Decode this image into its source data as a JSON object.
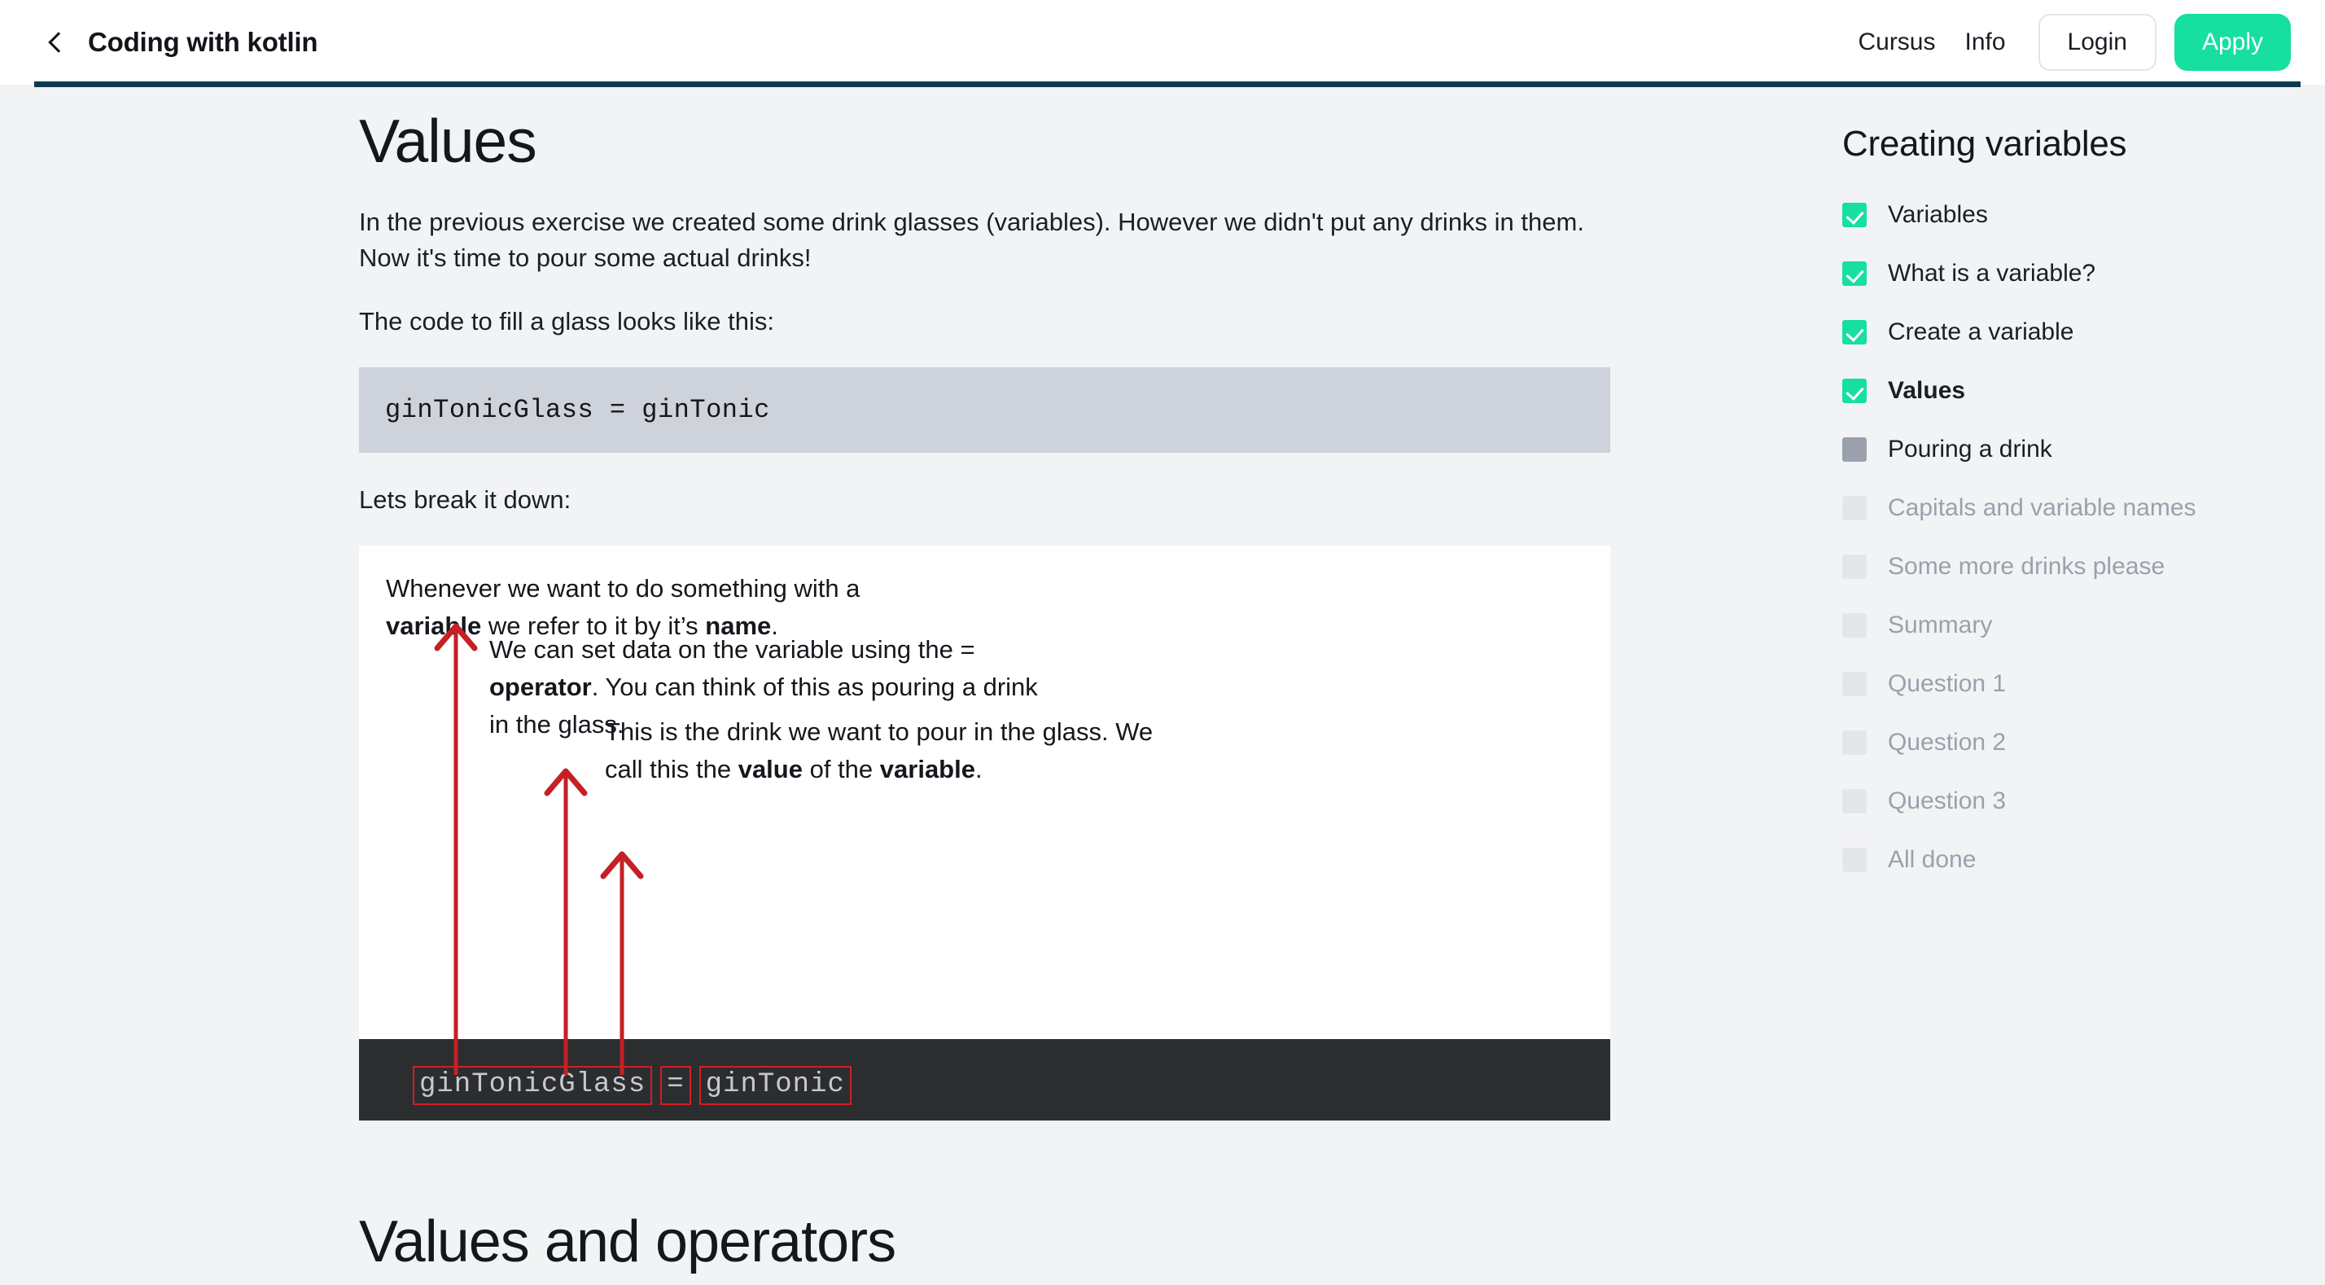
{
  "header": {
    "back_icon": "chevron-left-icon",
    "course_title": "Coding with kotlin",
    "nav": [
      {
        "label": "Cursus"
      },
      {
        "label": "Info"
      }
    ],
    "login_label": "Login",
    "apply_label": "Apply",
    "accent_green": "#16dfa0",
    "progress_color": "#0b3c4f"
  },
  "main": {
    "title": "Values",
    "paragraph_1": "In the previous exercise we created some drink glasses (variables). However we didn't put any drinks in them. Now it's time to pour some actual drinks!",
    "paragraph_2": "The code to fill a glass looks like this:",
    "code_snippet": "ginTonicGlass = ginTonic",
    "paragraph_3": "Lets break it down:",
    "section_title": "Values and operators"
  },
  "diagram": {
    "annotation_1": {
      "part_1": "Whenever we want to do something with a ",
      "bold_1": "variable",
      "part_2": " we refer to it by it’s ",
      "bold_2": "name",
      "part_3": "."
    },
    "annotation_2": {
      "part_1": "We can set data on the variable using the = ",
      "bold_1": "operator",
      "part_2": ". You can think of this as pouring a drink in the glass."
    },
    "annotation_3": {
      "part_1": "This is the drink we want to pour in the glass. We call this the ",
      "bold_1": "value",
      "part_2": " of the ",
      "bold_2": "variable",
      "part_3": "."
    },
    "code_tokens": [
      "ginTonicGlass",
      "=",
      "ginTonic"
    ],
    "arrow_color": "#c42026",
    "bar_color": "#2c2d2f"
  },
  "sidebar": {
    "title": "Creating variables",
    "items": [
      {
        "label": "Variables",
        "state": "done"
      },
      {
        "label": "What is a variable?",
        "state": "done"
      },
      {
        "label": "Create a variable",
        "state": "done"
      },
      {
        "label": "Values",
        "state": "done",
        "active": true
      },
      {
        "label": "Pouring a drink",
        "state": "current"
      },
      {
        "label": "Capitals and variable names",
        "state": "locked"
      },
      {
        "label": "Some more drinks please",
        "state": "locked"
      },
      {
        "label": "Summary",
        "state": "locked"
      },
      {
        "label": "Question 1",
        "state": "locked"
      },
      {
        "label": "Question 2",
        "state": "locked"
      },
      {
        "label": "Question 3",
        "state": "locked"
      },
      {
        "label": "All done",
        "state": "locked"
      }
    ]
  }
}
